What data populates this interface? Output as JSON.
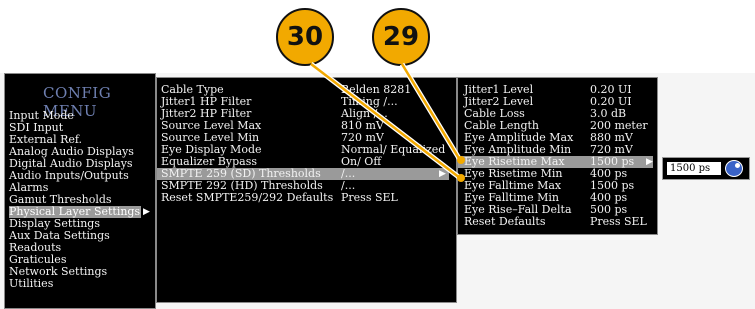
{
  "callouts": [
    "30",
    "29"
  ],
  "config_menu": {
    "title": "CONFIG MENU",
    "items": [
      "Input Mode",
      "SDI Input",
      "External Ref.",
      "Analog Audio Displays",
      "Digital Audio Displays",
      "Audio Inputs/Outputs",
      "Alarms",
      "Gamut Thresholds",
      "Physical Layer Settings",
      "Display Settings",
      "Aux Data Settings",
      "Readouts",
      "Graticules",
      "Network Settings",
      "Utilities"
    ],
    "selected": "Physical Layer Settings"
  },
  "physical_layer": {
    "labels": [
      "Cable Type",
      "Jitter1 HP Filter",
      "Jitter2 HP Filter",
      "Source Level Max",
      "Source Level Min",
      "Eye Display Mode",
      "Equalizer Bypass",
      "SMPTE 259 (SD) Thresholds",
      "SMPTE 292 (HD) Thresholds",
      "Reset SMPTE259/292 Defaults"
    ],
    "values": [
      "Belden 8281",
      "Timing /...",
      "Align /...",
      "810 mV",
      "720 mV",
      "Normal/ Equalized",
      "On/ Off",
      "/...",
      "/...",
      "Press SEL"
    ],
    "selected": "SMPTE 259 (SD) Thresholds"
  },
  "thresholds": {
    "labels": [
      "Jitter1 Level",
      "Jitter2 Level",
      "Cable Loss",
      "Cable Length",
      "Eye Amplitude Max",
      "Eye Amplitude Min",
      "Eye Risetime Max",
      "Eye Risetime Min",
      "Eye Falltime Max",
      "Eye Falltime Min",
      "Eye Rise–Fall Delta",
      "Reset Defaults"
    ],
    "values": [
      "0.20 UI",
      "0.20 UI",
      "3.0 dB",
      "200 meter",
      "880 mV",
      "720 mV",
      "1500 ps",
      "400 ps",
      "1500 ps",
      "400 ps",
      "500 ps",
      "Press SEL"
    ],
    "selected": "Eye Risetime Max"
  },
  "value_control": {
    "value": "1500 ps"
  }
}
